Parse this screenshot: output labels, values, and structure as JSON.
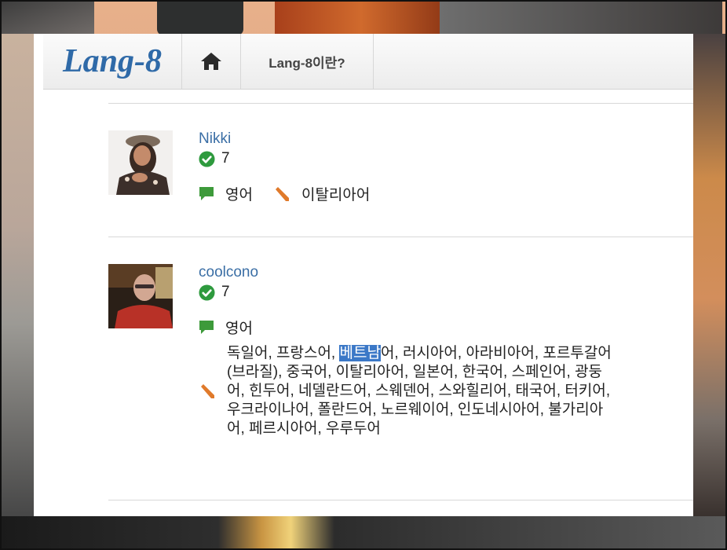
{
  "site": {
    "logo_text": "Lang-8",
    "nav": {
      "about_label": "Lang-8이란?"
    }
  },
  "users": [
    {
      "name": "Nikki",
      "score": "7",
      "native_language": "영어",
      "learning_language": "이탈리아어"
    },
    {
      "name": "coolcono",
      "score": "7",
      "native_language": "영어",
      "learning_languages_before": "독일어, 프랑스어, ",
      "learning_languages_highlight": "베트남",
      "learning_languages_after": "어, 러시아어, 아라비아어, 포르투갈어 (브라질), 중국어, 이탈리아어, 일본어, 한국어, 스페인어, 광둥어, 힌두어, 네델란드어, 스웨덴어, 스와힐리어, 태국어, 터키어, 우크라이나어, 폴란드어, 노르웨이어, 인도네시아어, 불가리아어, 페르시아어, 우루두어"
    }
  ],
  "colors": {
    "link": "#3a6ea5",
    "check_green": "#2e9a3e",
    "speech_green": "#3d9a3a",
    "pencil_orange": "#e07a2b",
    "selection": "#3b78c7"
  },
  "icons": {
    "home": "home-icon",
    "verified": "check-circle-icon",
    "native": "speech-bubble-icon",
    "learning": "pencil-icon"
  }
}
